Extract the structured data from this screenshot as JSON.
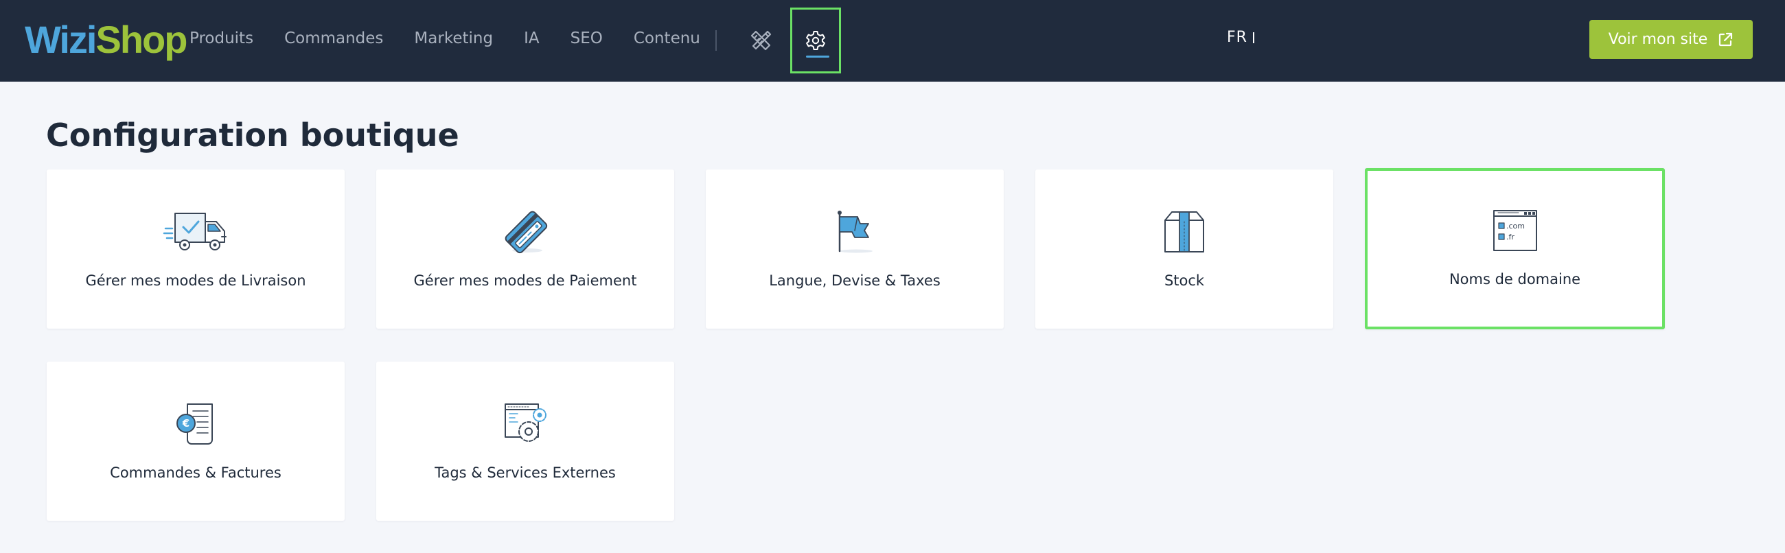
{
  "brand": {
    "part1": "Wizi",
    "part2": "Shop"
  },
  "nav": {
    "items": [
      {
        "label": "Produits"
      },
      {
        "label": "Commandes"
      },
      {
        "label": "Marketing"
      },
      {
        "label": "IA"
      },
      {
        "label": "SEO"
      },
      {
        "label": "Contenu"
      }
    ],
    "icons": [
      "design-tools-icon",
      "settings-gear-icon"
    ],
    "active_icon": "settings-gear-icon"
  },
  "header": {
    "language": "FR",
    "site_button_label": "Voir mon site",
    "site_button_icon": "external-link-icon"
  },
  "page": {
    "title": "Configuration boutique"
  },
  "cards": [
    {
      "label": "Gérer mes modes de Livraison",
      "icon": "delivery-truck-icon"
    },
    {
      "label": "Gérer mes modes de Paiement",
      "icon": "credit-card-icon"
    },
    {
      "label": "Langue, Devise & Taxes",
      "icon": "flag-icon"
    },
    {
      "label": "Stock",
      "icon": "box-icon"
    },
    {
      "label": "Noms de domaine",
      "icon": "domain-window-icon",
      "highlighted": true
    },
    {
      "label": "Commandes & Factures",
      "icon": "invoice-euro-icon"
    },
    {
      "label": "Tags & Services Externes",
      "icon": "tags-gear-icon"
    }
  ],
  "domain_icon_text": {
    "line1": ".com",
    "line2": ".fr"
  },
  "colors": {
    "topbar": "#202b3d",
    "accent_blue": "#4ea6dc",
    "accent_green": "#9dc33b",
    "highlight_outline": "#6be165",
    "page_background": "#f4f6fa"
  }
}
